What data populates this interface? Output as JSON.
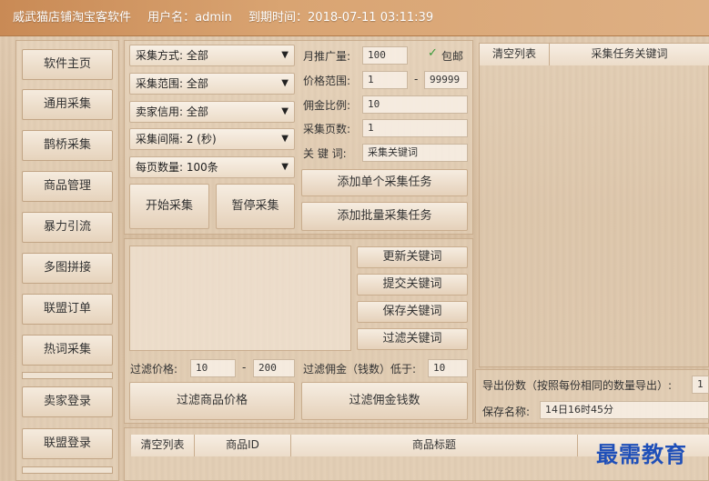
{
  "title": {
    "app_name": "威武猫店铺淘宝客软件",
    "user": "用户名：admin",
    "expiry": "到期时间：2018-07-11 03:11:39"
  },
  "nav": {
    "items": [
      "软件主页",
      "通用采集",
      "鹊桥采集",
      "商品管理",
      "暴力引流",
      "多图拼接",
      "联盟订单",
      "热词采集",
      "卖家登录",
      "联盟登录"
    ]
  },
  "collect": {
    "method": "采集方式: 全部",
    "range": "采集范围: 全部",
    "credit": "卖家信用: 全部",
    "interval": "采集间隔: 2 (秒)",
    "per_page": "每页数量: 100条",
    "monthly_label": "月推广量:",
    "monthly_value": "100",
    "free_ship": "包邮",
    "price_label": "价格范围:",
    "price_min": "1",
    "price_dash": "-",
    "price_max": "99999",
    "commission_label": "佣金比例:",
    "commission_value": "10",
    "pages_label": "采集页数:",
    "pages_value": "1",
    "keyword_label": "关 键 词:",
    "keyword_value": "采集关键词",
    "add_single": "添加单个采集任务",
    "add_batch": "添加批量采集任务",
    "start": "开始采集",
    "pause": "暂停采集"
  },
  "keywords": {
    "update": "更新关键词",
    "submit": "提交关键词",
    "save": "保存关键词",
    "filter": "过滤关键词"
  },
  "filter": {
    "price_label": "过滤价格:",
    "price_min": "10",
    "price_dash": "-",
    "price_max": "200",
    "commission_label": "过滤佣金（钱数）低于:",
    "commission_value": "10",
    "filter_price_btn": "过滤商品价格",
    "filter_commission_btn": "过滤佣金钱数"
  },
  "task_list": {
    "clear": "清空列表",
    "header": "采集任务关键词"
  },
  "export": {
    "count_label": "导出份数（按照每份相同的数量导出）:",
    "count_value": "1",
    "name_label": "保存名称:",
    "name_value": "14日16时45分"
  },
  "goods_table": {
    "clear": "清空列表",
    "col_id": "商品ID",
    "col_title": "商品标题"
  },
  "watermark": "最需教育"
}
